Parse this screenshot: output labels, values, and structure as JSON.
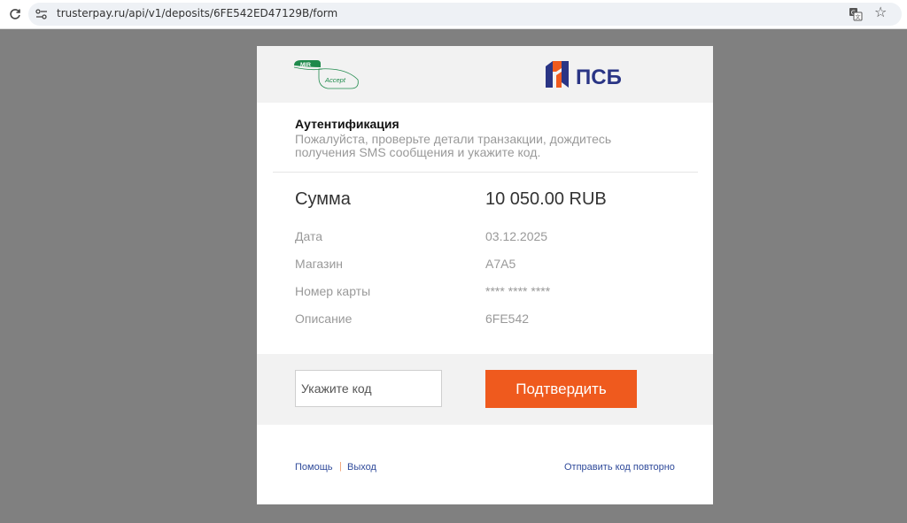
{
  "browser": {
    "url": "trusterpay.ru/api/v1/deposits/6FE542ED47129B/form"
  },
  "header": {
    "mir_logo_text": "MIR",
    "mir_logo_sub": "Accept",
    "bank_logo_text": "ПСБ",
    "bank_colors": {
      "blue": "#2a3585",
      "orange": "#ef5a1e"
    }
  },
  "auth": {
    "title": "Аутентификация",
    "description": "Пожалуйста, проверьте детали транзакции, дождитесь получения SMS сообщения и укажите код."
  },
  "transaction": {
    "sum_label": "Сумма",
    "sum_value": "10 050.00 RUB",
    "details": [
      {
        "label": "Дата",
        "value": "03.12.2025"
      },
      {
        "label": "Магазин",
        "value": "A7A5"
      },
      {
        "label": "Номер карты",
        "value": "**** **** **** "
      },
      {
        "label": "Описание",
        "value": "6FE542"
      }
    ]
  },
  "code_form": {
    "input_placeholder": "Укажите код",
    "confirm_label": "Подтвердить",
    "accent_color": "#ef5a1e"
  },
  "footer": {
    "help_label": "Помощь",
    "separator": "|",
    "exit_label": "Выход",
    "resend_label": "Отправить код повторно"
  }
}
